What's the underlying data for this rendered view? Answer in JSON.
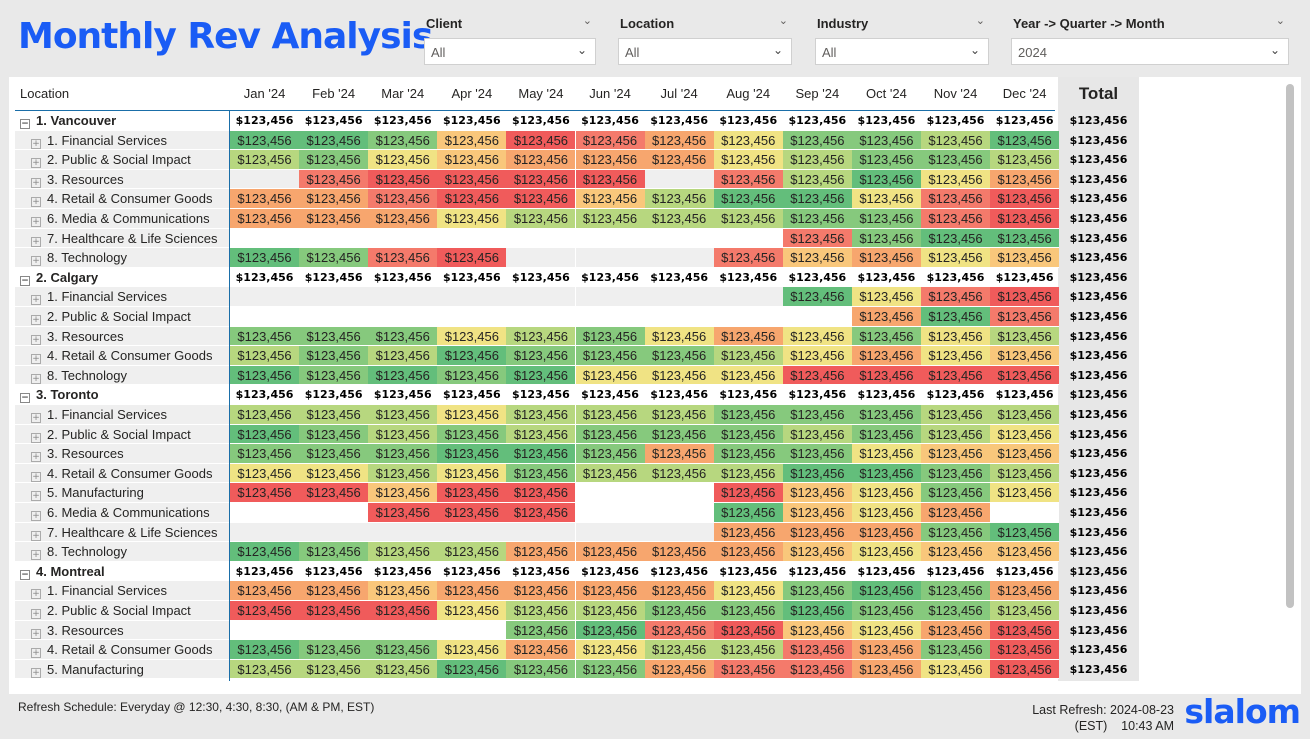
{
  "title": "Monthly Rev Analysis",
  "brand_color": "#1a5cf5",
  "slicers": [
    {
      "label": "Client",
      "value": "All"
    },
    {
      "label": "Location",
      "value": "All"
    },
    {
      "label": "Industry",
      "value": "All"
    },
    {
      "label": "Year -> Quarter -> Month",
      "value": "2024"
    }
  ],
  "matrix": {
    "row_header": "Location",
    "months": [
      "Jan '24",
      "Feb '24",
      "Mar '24",
      "Apr '24",
      "May '24",
      "Jun '24",
      "Jul '24",
      "Aug '24",
      "Sep '24",
      "Oct '24",
      "Nov '24",
      "Dec '24"
    ],
    "total_header": "Total",
    "cell_value": "$123,456",
    "color_scale": {
      "g": "#63be7b",
      "G": "#86c97d",
      "l": "#b7d77f",
      "y": "#f0e384",
      "o": "#f9c77b",
      "O": "#f7a66e",
      "r": "#f47a6b",
      "R": "#f05b5b",
      "e": "#efefef",
      "w": "#ffffff"
    },
    "rows": [
      {
        "type": "parent",
        "label": "1. Vancouver",
        "pattern": "vvvvvvvvvvvv"
      },
      {
        "type": "child",
        "label": "1. Financial Services",
        "pattern": "ggGoRrOyGGlg"
      },
      {
        "type": "child",
        "label": "2. Public & Social Impact",
        "pattern": "lGyoOOOylGGl"
      },
      {
        "type": "child",
        "label": "3. Resources",
        "pattern": "erRRRRerlgyO"
      },
      {
        "type": "child",
        "label": "4. Retail & Consumer Goods",
        "pattern": "OOrRRolggyrR"
      },
      {
        "type": "child",
        "label": "6. Media & Communications",
        "pattern": "OOOyllllGGrR"
      },
      {
        "type": "child",
        "label": "7. Healthcare & Life Sciences",
        "pattern": "wwwwwwwwrGgg"
      },
      {
        "type": "child",
        "label": "8. Technology",
        "pattern": "gGrReeeroOyo"
      },
      {
        "type": "parent",
        "label": "2. Calgary",
        "pattern": "vvvvvvvvvvvv"
      },
      {
        "type": "child",
        "label": "1. Financial Services",
        "pattern": "eeeeeeeegyrR"
      },
      {
        "type": "child",
        "label": "2. Public & Social Impact",
        "pattern": "wwwwwwwwwOgr"
      },
      {
        "type": "child",
        "label": "3. Resources",
        "pattern": "GGGylGyOyGyl"
      },
      {
        "type": "child",
        "label": "4. Retail & Consumer Goods",
        "pattern": "lGlgGGGlyOyo"
      },
      {
        "type": "child",
        "label": "8. Technology",
        "pattern": "gGgGgyyyRRRR"
      },
      {
        "type": "parent",
        "label": "3. Toronto",
        "pattern": "vvvvvvvvvvvv"
      },
      {
        "type": "child",
        "label": "1. Financial Services",
        "pattern": "lllylllGGGll"
      },
      {
        "type": "child",
        "label": "2. Public & Social Impact",
        "pattern": "gGlGlGGGlGly"
      },
      {
        "type": "child",
        "label": "3. Resources",
        "pattern": "GGGggGOGGyoo"
      },
      {
        "type": "child",
        "label": "4. Retail & Consumer Goods",
        "pattern": "yylyGlllggGl"
      },
      {
        "type": "child",
        "label": "5. Manufacturing",
        "pattern": "RRoRRwwRoyGy"
      },
      {
        "type": "child",
        "label": "6. Media & Communications",
        "pattern": "wwRRRwwgoyOw"
      },
      {
        "type": "child",
        "label": "7. Healthcare & Life Sciences",
        "pattern": "eeeeeeeOOOGg"
      },
      {
        "type": "child",
        "label": "8. Technology",
        "pattern": "gGllOOOOoyoo"
      },
      {
        "type": "parent",
        "label": "4. Montreal",
        "pattern": "vvvvvvvvvvvv"
      },
      {
        "type": "child",
        "label": "1. Financial Services",
        "pattern": "OOoOOOOyGgGO"
      },
      {
        "type": "child",
        "label": "2. Public & Social Impact",
        "pattern": "RRRyllGGgGGl"
      },
      {
        "type": "child",
        "label": "3. Resources",
        "pattern": "wwwwGgrRoyOR"
      },
      {
        "type": "child",
        "label": "4. Retail & Consumer Goods",
        "pattern": "gGGyOyllrOGR"
      },
      {
        "type": "child",
        "label": "5. Manufacturing",
        "pattern": "lllgGGOrrOyR"
      }
    ]
  },
  "footer": {
    "refresh_schedule": "Refresh Schedule: Everyday @ 12:30, 4:30, 8:30, (AM & PM, EST)",
    "last_refresh_line1": "Last Refresh: 2024-08-23",
    "last_refresh_line2": "(EST)    10:43 AM",
    "logo": "slalom"
  }
}
